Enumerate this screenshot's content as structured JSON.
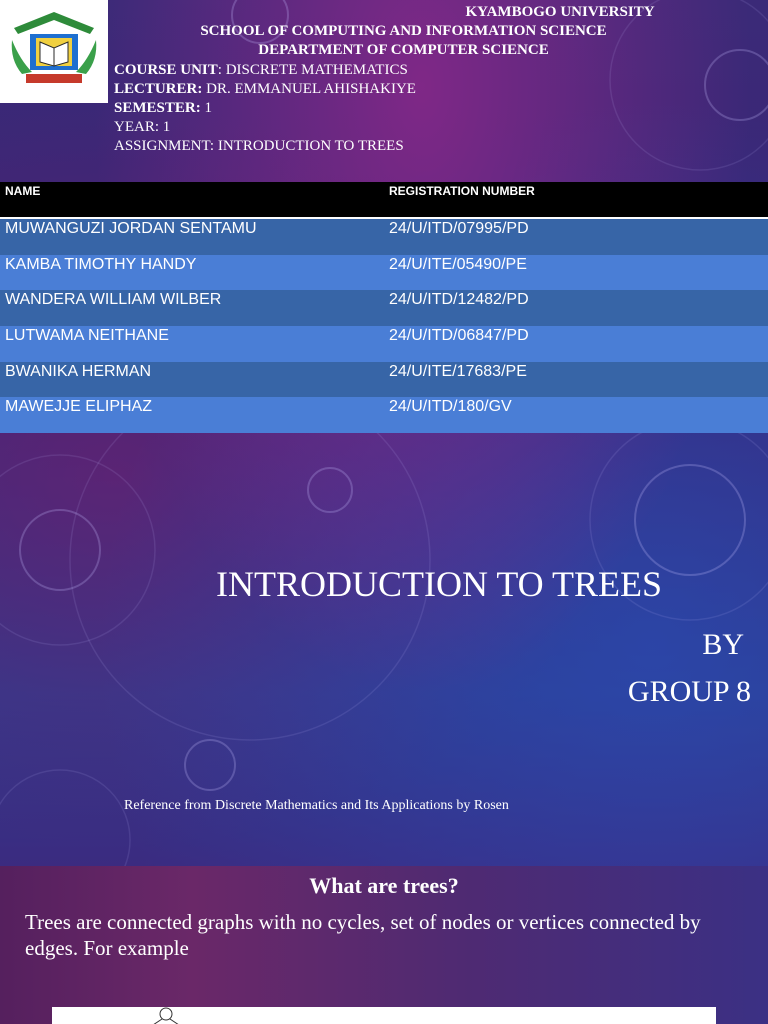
{
  "header": {
    "university": "KYAMBOGO UNIVERSITY",
    "school": "SCHOOL OF COMPUTING AND INFORMATION SCIENCE",
    "department": "DEPARTMENT OF COMPUTER SCIENCE",
    "course_label": "COURSE UNIT",
    "course_value": ": DISCRETE MATHEMATICS",
    "lecturer_label": "LECTURER:",
    "lecturer_value": " DR. EMMANUEL AHISHAKIYE",
    "semester_label": "SEMESTER:",
    "semester_value": " 1",
    "year": "YEAR: 1",
    "assignment": "ASSIGNMENT: INTRODUCTION TO TREES"
  },
  "logo": {
    "icon": "university-crest-logo"
  },
  "table": {
    "headers": [
      "NAME",
      "REGISTRATION NUMBER"
    ],
    "rows": [
      [
        "MUWANGUZI JORDAN SENTAMU",
        "24/U/ITD/07995/PD"
      ],
      [
        "KAMBA TIMOTHY HANDY",
        "24/U/ITE/05490/PE"
      ],
      [
        "WANDERA WILLIAM WILBER",
        "24/U/ITD/12482/PD"
      ],
      [
        "LUTWAMA NEITHANE",
        "24/U/ITD/06847/PD"
      ],
      [
        "BWANIKA HERMAN",
        "24/U/ITE/17683/PE"
      ],
      [
        "MAWEJJE ELIPHAZ",
        "24/U/ITD/180/GV"
      ]
    ],
    "row_colors": [
      "#3765a7",
      "#4a7ed6"
    ]
  },
  "slide1": {
    "title": "INTRODUCTION TO TREES",
    "by": "BY",
    "group": "GROUP 8",
    "reference": "Reference from Discrete Mathematics and Its Applications by Rosen"
  },
  "slide2": {
    "heading": "What are trees?",
    "paragraph": "Trees are  connected graphs with no cycles, set of nodes or vertices connected by edges. For example"
  },
  "colors": {
    "table_header_bg": "#000000",
    "text": "#ffffff"
  }
}
